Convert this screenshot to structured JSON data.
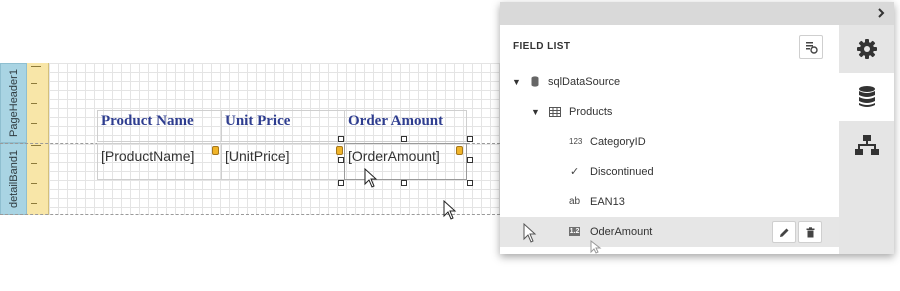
{
  "designer": {
    "bands": {
      "page_header_label": "PageHeader1",
      "detail_label": "detailBand1"
    },
    "headers": [
      "Product Name",
      "Unit Price",
      "Order Amount"
    ],
    "fields": [
      "[ProductName]",
      "[UnitPrice]",
      "[OrderAmount]"
    ]
  },
  "field_list": {
    "title": "FIELD LIST",
    "data_source": {
      "label": "sqlDataSource",
      "icon": "database-icon"
    },
    "table": {
      "label": "Products",
      "icon": "table-icon"
    },
    "fields": [
      {
        "label": "CategoryID",
        "type_glyph": "123",
        "icon": "integer-type-icon"
      },
      {
        "label": "Discontinued",
        "type_glyph": "✓",
        "icon": "boolean-type-icon"
      },
      {
        "label": "EAN13",
        "type_glyph": "ab",
        "icon": "string-type-icon"
      },
      {
        "label": "OderAmount",
        "type_glyph": "1.2",
        "icon": "decimal-type-icon",
        "selected": true
      }
    ]
  },
  "side_tabs": [
    {
      "name": "properties",
      "icon": "gear-icon"
    },
    {
      "name": "field-list",
      "icon": "database-icon",
      "active": true
    },
    {
      "name": "report-explorer",
      "icon": "hierarchy-icon"
    }
  ],
  "colors": {
    "band_label_bg": "#a9d4e3",
    "ruler_bg": "#f8e6a8",
    "header_text": "#2e3d8f",
    "smart_tag": "#f0b429",
    "panel_header": "#d9d9d9",
    "tab_bar": "#e5e5e5",
    "selected_row": "#e6e6e6"
  }
}
